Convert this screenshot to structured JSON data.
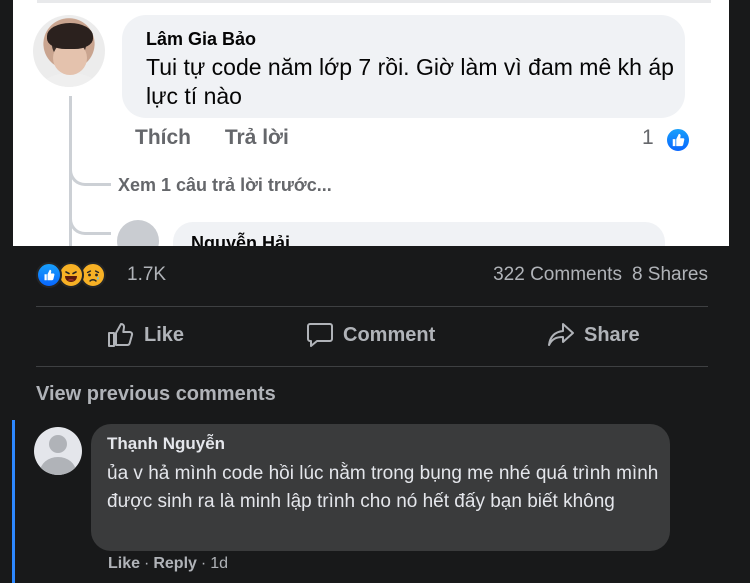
{
  "embedded_screenshot": {
    "comment": {
      "author": "Lâm Gia Bảo",
      "text": "Tui tự code năm lớp 7 rồi. Giờ làm vì đam mê kh áp lực tí nào",
      "like_label": "Thích",
      "reply_label": "Trả lời",
      "reaction_count": "1"
    },
    "view_more_replies": "Xem 1 câu trả lời trước...",
    "reply_author": "Nguyễn Hải"
  },
  "post": {
    "reaction_count": "1.7K",
    "comments_count": "322 Comments",
    "shares_count": "8 Shares",
    "actions": {
      "like": "Like",
      "comment": "Comment",
      "share": "Share"
    },
    "view_previous": "View previous comments"
  },
  "comment": {
    "author": "Thạnh Nguyễn",
    "text": "ủa v hả mình code hồi lúc nằm trong bụng mẹ nhé quá trình mình được sinh ra là minh lập trình cho nó hết đấy bạn biết không",
    "like_label": "Like",
    "reply_label": "Reply",
    "time": "1d"
  },
  "colors": {
    "background": "#18191a",
    "bubble_dark": "#3a3b3c",
    "text_primary": "#e4e6eb",
    "text_secondary": "#b0b3b8",
    "accent": "#2d88ff"
  }
}
